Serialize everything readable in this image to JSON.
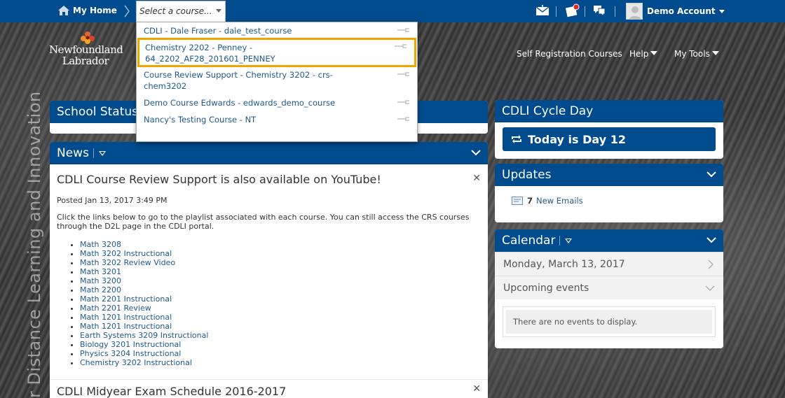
{
  "topbar": {
    "home_label": "My Home",
    "course_select_value": "Select a course...",
    "account_name": "Demo Account"
  },
  "dropdown": {
    "items": [
      {
        "lines": [
          "CDLI - Dale Fraser - dale_test_course"
        ],
        "selected": false
      },
      {
        "lines": [
          "Chemistry 2202 - Penney -",
          "64_2202_AF28_201601_PENNEY"
        ],
        "selected": true
      },
      {
        "lines": [
          "Course Review Support - Chemistry 3202 - crs-",
          "chem3202"
        ],
        "selected": false
      },
      {
        "lines": [
          "Demo Course Edwards - edwards_demo_course"
        ],
        "selected": false
      },
      {
        "lines": [
          "Nancy's Testing Course - NT"
        ],
        "selected": false
      }
    ]
  },
  "logo": {
    "line1": "Newfoundland",
    "line2": "Labrador"
  },
  "nav": {
    "self_registration": "Self Registration Courses",
    "help": "Help",
    "my_tools": "My Tools"
  },
  "tagline": "r Distance Learning and Innovation",
  "school_status": {
    "title": "School Status"
  },
  "news": {
    "title": "News",
    "items": [
      {
        "title": "CDLI Course Review Support is also available on YouTube!",
        "date": "Posted Jan 13, 2017 3:49 PM",
        "text": "Click the links below to go to the playlist associated with each course. You can still access the CRS courses through the D2L page in the CDLI portal.",
        "links": [
          "Math 3208",
          "Math 3202 Instructional",
          "Math 3202 Review Video",
          "Math 3201",
          "Math 3200",
          "Math 2200",
          "Math 2201 Instructional",
          "Math 2201 Review",
          "Math 1201 Instructional",
          "Math 1201 Instructional",
          "Earth Systems 3209 Instructional",
          "Biology 3201 Instructional",
          "Physics 3204 Instructional",
          "Chemistry 3202 Instructional"
        ]
      },
      {
        "title": "CDLI Midyear Exam Schedule 2016-2017"
      }
    ]
  },
  "cycle_day": {
    "title": "CDLI Cycle Day",
    "button": "Today is Day 12"
  },
  "updates": {
    "title": "Updates",
    "count": "7",
    "label": "New Emails"
  },
  "calendar": {
    "title": "Calendar",
    "date": "Monday, March 13, 2017",
    "upcoming": "Upcoming events",
    "empty": "There are no events to display."
  },
  "colors": {
    "brand_blue": "#004b8d",
    "selected_outline": "#f0a500",
    "link": "#1d5a8c"
  }
}
